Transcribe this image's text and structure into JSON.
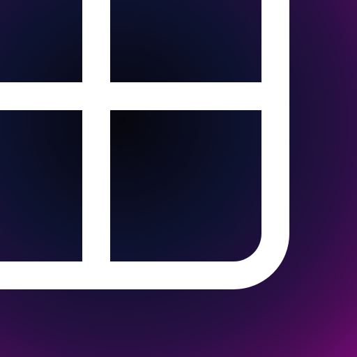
{
  "icon": {
    "name": "grid-layout-icon",
    "stroke_color": "#ffffff",
    "background_colors": [
      "#07070f",
      "#0d1230",
      "#2a0f45",
      "#4a0c57",
      "#6e0a6e"
    ]
  }
}
